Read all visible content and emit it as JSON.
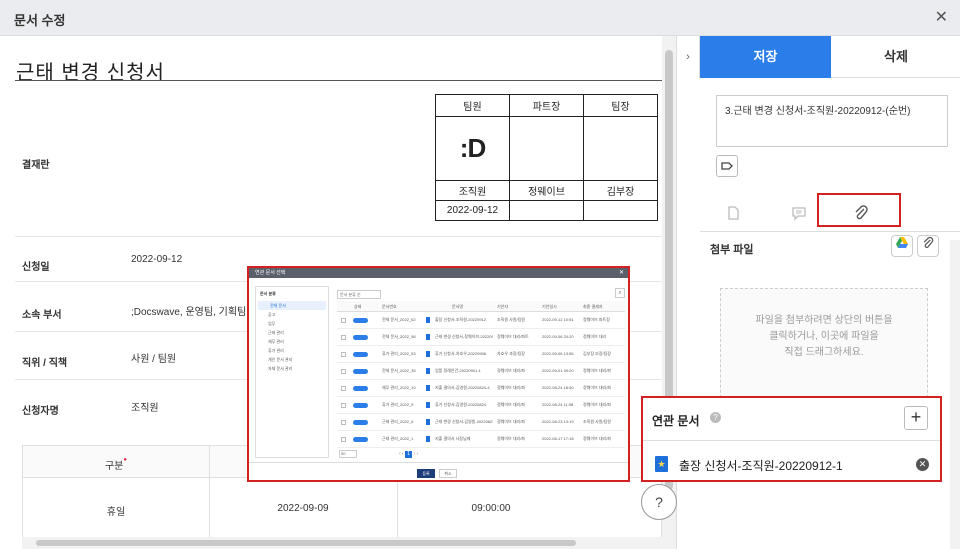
{
  "window": {
    "title": "문서 수정",
    "close_label": "✕"
  },
  "document": {
    "title": "근태 변경 신청서",
    "fields": [
      {
        "label": "결재란",
        "value": ""
      },
      {
        "label": "신청일",
        "value": "2022-09-12"
      },
      {
        "label": "소속 부서",
        "value": ";Docswave, 운영팀, 기획팀"
      },
      {
        "label": "직위 / 직책",
        "value": "사원 / 팀원"
      },
      {
        "label": "신청자명",
        "value": "조직원"
      }
    ],
    "approval": {
      "headers": [
        "팀원",
        "파트장",
        "팀장"
      ],
      "stamp": ":D",
      "names": [
        "조직원",
        "정웨이브",
        "김부장"
      ],
      "dates": [
        "2022-09-12",
        "",
        ""
      ]
    },
    "grid": {
      "header_label": "구분",
      "required_mark": "●",
      "row": [
        "휴일",
        "2022-09-09",
        "09:00:00"
      ]
    }
  },
  "panel": {
    "collapse_label": "›",
    "save_label": "저장",
    "delete_label": "삭제",
    "doc_name": "3.근태 변경 신청서-조직원-20220912-(순번)",
    "attach_title": "첨부 파일",
    "drop_text": [
      "파일을 첨부하려면 상단의 버튼을",
      "클릭하거나, 이곳에 파일을",
      "직접 드래그하세요."
    ]
  },
  "related": {
    "title": "연관 문서",
    "help": "?",
    "add_label": "+",
    "item": "출장 신청서-조직원-20220912-1",
    "remove_label": "✕"
  },
  "popup": {
    "title": "연관 문서 선택",
    "close_label": "✕",
    "tree_header": "문서 분류",
    "tree_items": [
      "전체 문서",
      "공고",
      "업무",
      "근태 관리",
      "재무 관리",
      "휴가 관리",
      "개인 문서 관리",
      "자체 문서 관리"
    ],
    "filter": "문서 분류 순",
    "columns": [
      "상태",
      "문서번호",
      "문서명",
      "기안자",
      "기안일시",
      "최종 결재자"
    ],
    "rows": [
      [
        "진행중",
        "전체 문서_2022_62",
        "출장 신청서-조직원-20220912",
        "조직원 사원/팀원",
        "2022-09-12 10:51",
        "정웨이브 파트장"
      ],
      [
        "진행중",
        "전체 문서_2022_58",
        "근태 변경 신청서-정웨이브-20220906",
        "정웨이브 대리/파트",
        "2022-09-06 20:20",
        "정웨이브 대리"
      ],
      [
        "진행중",
        "휴가 관리_2022_53",
        "휴가 신청서-차호우-20220906",
        "차호우 과장/팀장",
        "2022-09-06 13:56",
        "김부장 부장/팀장"
      ],
      [
        "진행중",
        "전체 문서_2022_35",
        "업품 정례안건-20220901-1",
        "정웨이브 대리/파",
        "2022-09-01 09:20",
        "정웨이브 대리/파"
      ],
      [
        "진행중",
        "재무 관리_2022_10",
        "지출 결의서-김영원-20220824-4",
        "정웨이브 대리/파",
        "2022-08-24 18:50",
        "정웨이브 대리/파"
      ],
      [
        "진행중",
        "휴가 관리_2022_9",
        "휴가 신청서-김영원-20220824",
        "정웨이브 대리/파",
        "2022-08-24 11:08",
        "정웨이브 대리/파"
      ],
      [
        "진행중",
        "근태 관리_2022_6",
        "근태 변경 신청서-김영원-20220823-1",
        "정웨이브 대리/파",
        "2022-08-23 13:19",
        "조직원 사원/팀원"
      ],
      [
        "진행중",
        "근태 관리_2022_1",
        "지출 결의서 사장님께",
        "정웨이브 대리/파",
        "2022-08-17 17:18",
        "정웨이브 대리/파"
      ]
    ],
    "page_size": "50",
    "pager_prev": "‹ ‹",
    "page_current": "1",
    "pager_next": "› ›",
    "confirm_label": "등록",
    "cancel_label": "취소"
  },
  "help_label": "?"
}
